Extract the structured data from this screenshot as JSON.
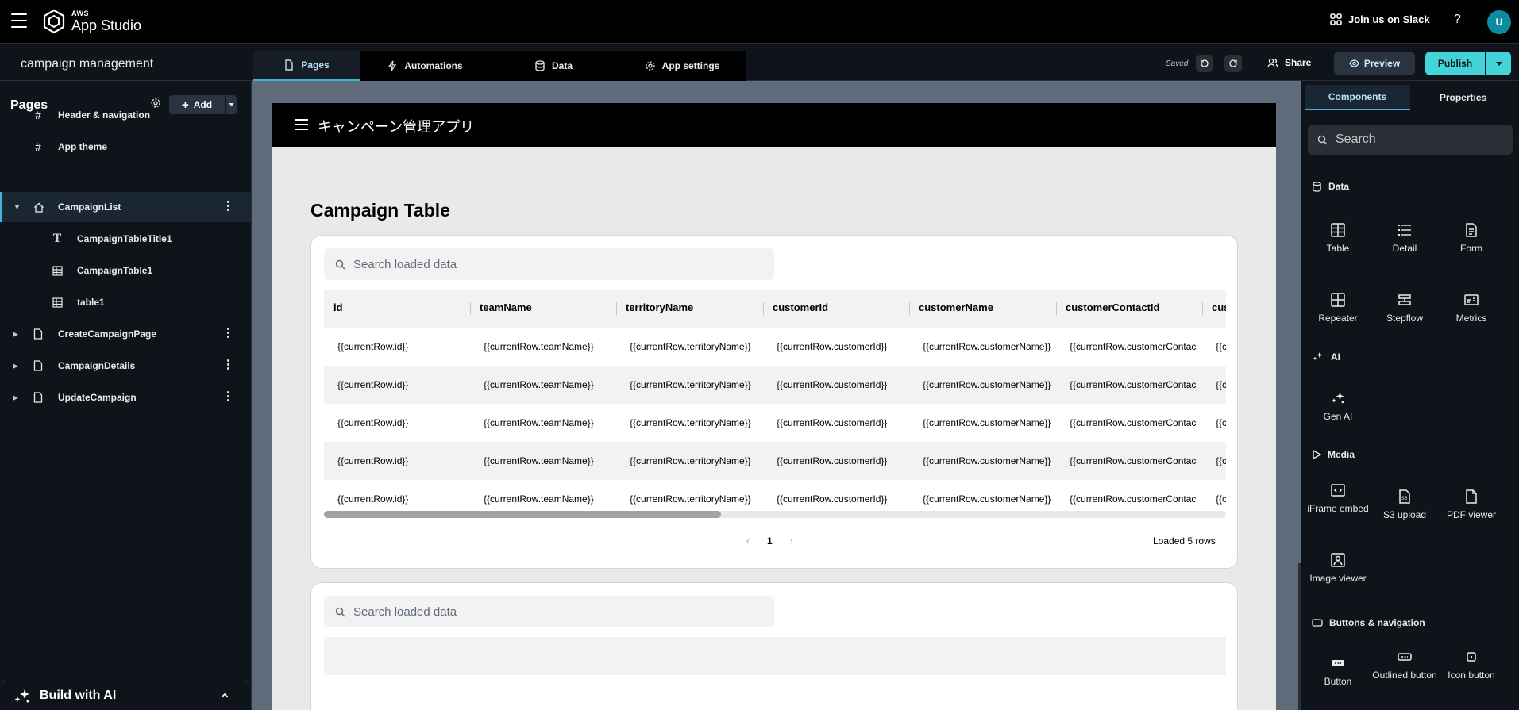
{
  "topbar": {
    "logo_small": "AWS",
    "logo_big": "App Studio",
    "slack": "Join us on Slack",
    "help": "?",
    "avatar": "U"
  },
  "secondbar": {
    "app_name": "campaign management",
    "tabs": [
      {
        "label": "Pages",
        "active": true
      },
      {
        "label": "Automations"
      },
      {
        "label": "Data"
      },
      {
        "label": "App settings"
      }
    ],
    "saved": "Saved",
    "share": "Share",
    "preview": "Preview",
    "publish": "Publish"
  },
  "sidebar": {
    "title": "Pages",
    "add": "Add",
    "items": [
      {
        "label": "Header & navigation",
        "icon": "hash-icon"
      },
      {
        "label": "App theme",
        "icon": "hash-icon"
      },
      {
        "label": "CampaignList",
        "icon": "home-icon",
        "selected": true
      },
      {
        "label": "CampaignTableTitle1",
        "icon": "text-icon"
      },
      {
        "label": "CampaignTable1",
        "icon": "table-icon"
      },
      {
        "label": "table1",
        "icon": "table-icon"
      },
      {
        "label": "CreateCampaignPage",
        "icon": "page-icon"
      },
      {
        "label": "CampaignDetails",
        "icon": "page-icon"
      },
      {
        "label": "UpdateCampaign",
        "icon": "page-icon"
      }
    ],
    "build_ai": "Build with AI"
  },
  "canvas": {
    "app_title": "キャンペーン管理アプリ",
    "table_heading": "Campaign Table",
    "search_placeholder": "Search loaded data",
    "columns": [
      "id",
      "teamName",
      "territoryName",
      "customerId",
      "customerName",
      "customerContactId",
      "cus"
    ],
    "row_cells": [
      "{{currentRow.id}}",
      "{{currentRow.teamName}}",
      "{{currentRow.territoryName}}",
      "{{currentRow.customerId}}",
      "{{currentRow.customerName}}",
      "{{currentRow.customerContac",
      "{{c"
    ],
    "page": "1",
    "loaded": "Loaded 5 rows",
    "search_placeholder_2": "Search loaded data"
  },
  "rpanel": {
    "tabs": [
      {
        "label": "Components",
        "active": true
      },
      {
        "label": "Properties"
      }
    ],
    "search_placeholder": "Search",
    "sections": {
      "data": "Data",
      "ai": "AI",
      "media": "Media",
      "buttons": "Buttons & navigation"
    },
    "data_items": [
      "Table",
      "Detail",
      "Form",
      "Repeater",
      "Stepflow",
      "Metrics"
    ],
    "ai_items": [
      "Gen AI"
    ],
    "media_items": [
      "iFrame embed",
      "S3 upload",
      "PDF viewer",
      "Image viewer"
    ],
    "button_items": [
      "Button",
      "Outlined button",
      "Icon button"
    ]
  },
  "colors": {
    "accent": "#42b4d8",
    "publish": "#42d4d8",
    "background": "#0f141a"
  }
}
